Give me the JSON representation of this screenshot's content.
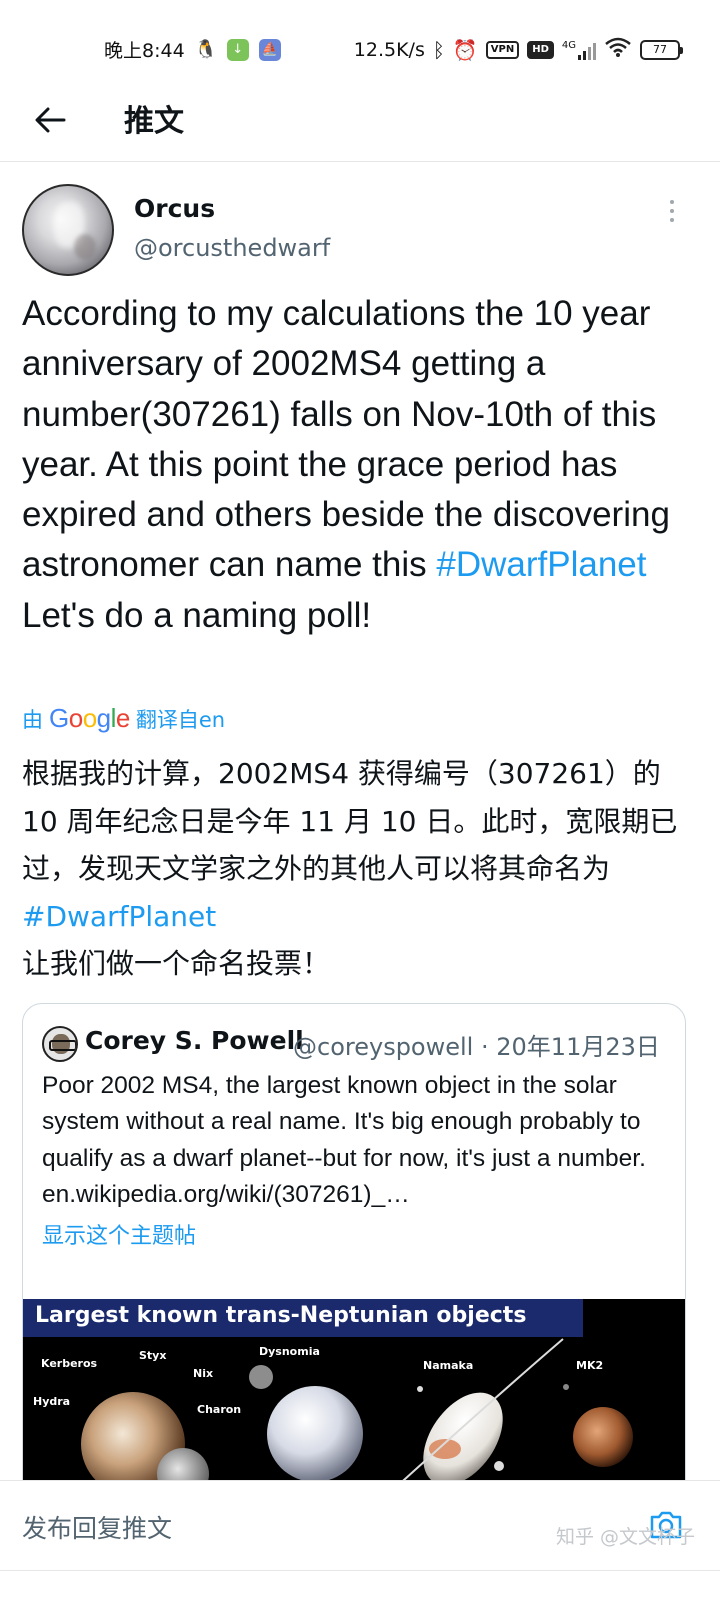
{
  "status_bar": {
    "time": "晚上8:44",
    "speed": "12.5K/s",
    "vpn": "VPN",
    "hd": "HD",
    "network": "4G",
    "battery": "77",
    "icons": [
      "qq-icon",
      "download-icon",
      "boat-app-icon",
      "bluetooth-icon",
      "alarm-icon",
      "signal-icon",
      "wifi-icon"
    ]
  },
  "header": {
    "title": "推文"
  },
  "tweet": {
    "author_name": "Orcus",
    "author_handle": "@orcusthedwarf",
    "text_before_hashtag": "According to my calculations the 10 year anniversary of 2002MS4 getting a number(307261) falls on Nov-10th of this year. At this point the grace period has expired and others beside the discovering astronomer can name this ",
    "hashtag": "#DwarfPlanet",
    "text_after_hashtag": "Let's do a naming poll!",
    "translation_prefix": "由",
    "translation_brand": "Google",
    "translation_suffix": "翻译自en",
    "translated_before_hashtag": "根据我的计算，2002MS4 获得编号（307261）的 10 周年纪念日是今年 11 月 10 日。此时，宽限期已过，发现天文学家之外的其他人可以将其命名为",
    "translated_hashtag": "#DwarfPlanet",
    "translated_after_hashtag": "让我们做一个命名投票！"
  },
  "quoted_tweet": {
    "author_name": "Corey S. Powell",
    "author_handle": "@coreyspowell",
    "separator": "·",
    "date": "20年11月23日",
    "text": "Poor 2002 MS4, the largest known object in the solar system without a real name. It's big enough probably to qualify as a dwarf planet--but for now, it's just a number.   en.wikipedia.org/wiki/(307261)_…",
    "show_thread": "显示这个主题帖",
    "image_title": "Largest known trans-Neptunian objects",
    "image_labels": [
      "Kerberos",
      "Styx",
      "Nix",
      "Hydra",
      "Charon",
      "Dysnomia",
      "Namaka",
      "MK2"
    ]
  },
  "reply_bar": {
    "placeholder": "发布回复推文"
  },
  "watermark": "知乎 @文文杯子",
  "colors": {
    "link": "#1d9bf0",
    "text": "#0f1419",
    "secondary": "#536471",
    "border": "#cfd9de"
  }
}
